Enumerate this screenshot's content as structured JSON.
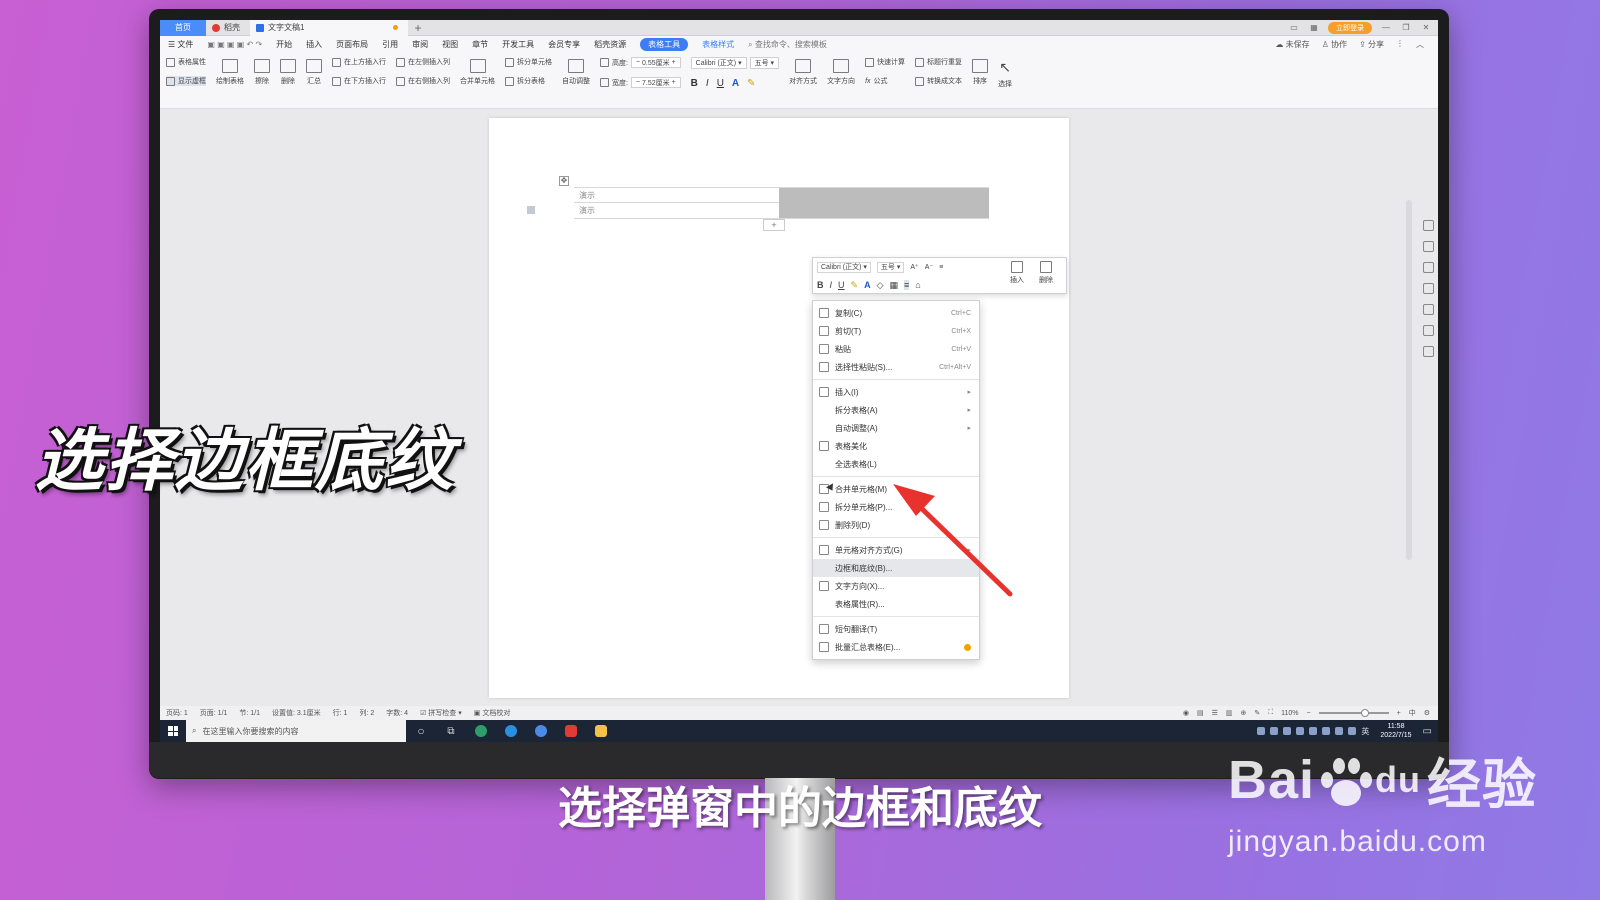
{
  "titlebar": {
    "home_tab": "首页",
    "tab_daoke": "稻壳",
    "doc_tab": "文字文稿1",
    "add_tab": "+",
    "login_btn": "立即登录"
  },
  "menubar": {
    "file": "文件",
    "items": [
      "开始",
      "插入",
      "页面布局",
      "引用",
      "审阅",
      "视图",
      "章节",
      "开发工具",
      "会员专享",
      "稻壳资源"
    ],
    "table_tools": "表格工具",
    "table_style": "表格样式",
    "search": "查找命令、搜索模板",
    "unsaved": "未保存",
    "collab": "协作",
    "share": "分享"
  },
  "ribbon": {
    "table_props": "表格属性",
    "show_gridlines": "显示虚框",
    "draw_table": "绘制表格",
    "erase": "擦除",
    "delete": "删除",
    "summary": "汇总",
    "insert_above": "在上方插入行",
    "insert_below": "在下方插入行",
    "insert_left": "在左侧插入列",
    "insert_right": "在右侧插入列",
    "merge_cells": "合并单元格",
    "split_cells": "拆分单元格",
    "split_table": "拆分表格",
    "autofit": "自动调整",
    "height_label": "高度:",
    "height_value": "0.55厘米",
    "width_label": "宽度:",
    "width_value": "7.52厘米",
    "font_name": "Calibri (正文)",
    "font_size": "五号",
    "align": "对齐方式",
    "text_dir": "文字方向",
    "quick_calc": "快速计算",
    "repeat_header": "标题行重复",
    "formula": "公式",
    "to_text": "转换成文本",
    "sort": "排序",
    "select": "选择"
  },
  "document": {
    "cell_1": "演示",
    "cell_2": "演示",
    "add_row": "+"
  },
  "mini_toolbar": {
    "font": "Calibri (正文)",
    "size": "五号",
    "insert": "插入",
    "delete": "删除"
  },
  "context_menu": {
    "items": [
      {
        "label": "复制(C)",
        "shortcut": "Ctrl+C"
      },
      {
        "label": "剪切(T)",
        "shortcut": "Ctrl+X"
      },
      {
        "label": "粘贴",
        "shortcut": "Ctrl+V"
      },
      {
        "label": "选择性粘贴(S)...",
        "shortcut": "Ctrl+Alt+V"
      },
      {
        "label": "插入(I)"
      },
      {
        "label": "拆分表格(A)"
      },
      {
        "label": "自动调整(A)"
      },
      {
        "label": "表格美化"
      },
      {
        "label": "全选表格(L)"
      },
      {
        "label": "合并单元格(M)"
      },
      {
        "label": "拆分单元格(P)..."
      },
      {
        "label": "删除列(D)"
      },
      {
        "label": "单元格对齐方式(G)"
      },
      {
        "label": "边框和底纹(B)..."
      },
      {
        "label": "文字方向(X)..."
      },
      {
        "label": "表格属性(R)..."
      },
      {
        "label": "短句翻译(T)"
      },
      {
        "label": "批量汇总表格(E)..."
      }
    ]
  },
  "statusbar": {
    "page_num": "页码: 1",
    "pages": "页面: 1/1",
    "section": "节: 1/1",
    "setting": "设置值: 3.1厘米",
    "row": "行: 1",
    "col": "列: 2",
    "words": "字数: 4",
    "spell": "拼写检查",
    "proof": "文档校对",
    "zoom": "110%",
    "ime": "中"
  },
  "taskbar": {
    "search_placeholder": "在这里输入你要搜索的内容",
    "time": "11:58",
    "date": "2022/7/15",
    "lang": "英"
  },
  "overlay": {
    "big_caption": "选择边框底纹",
    "subtitle": "选择弹窗中的边框和底纹",
    "watermark_a": "Bai",
    "watermark_b": "经验",
    "watermark_du": "du",
    "watermark_url": "jingyan.baidu.com"
  },
  "colors": {
    "accent": "#3d7cf2",
    "arrow": "#e8322e",
    "bg_left": "#c85fd3",
    "bg_right": "#8f7ae6"
  }
}
